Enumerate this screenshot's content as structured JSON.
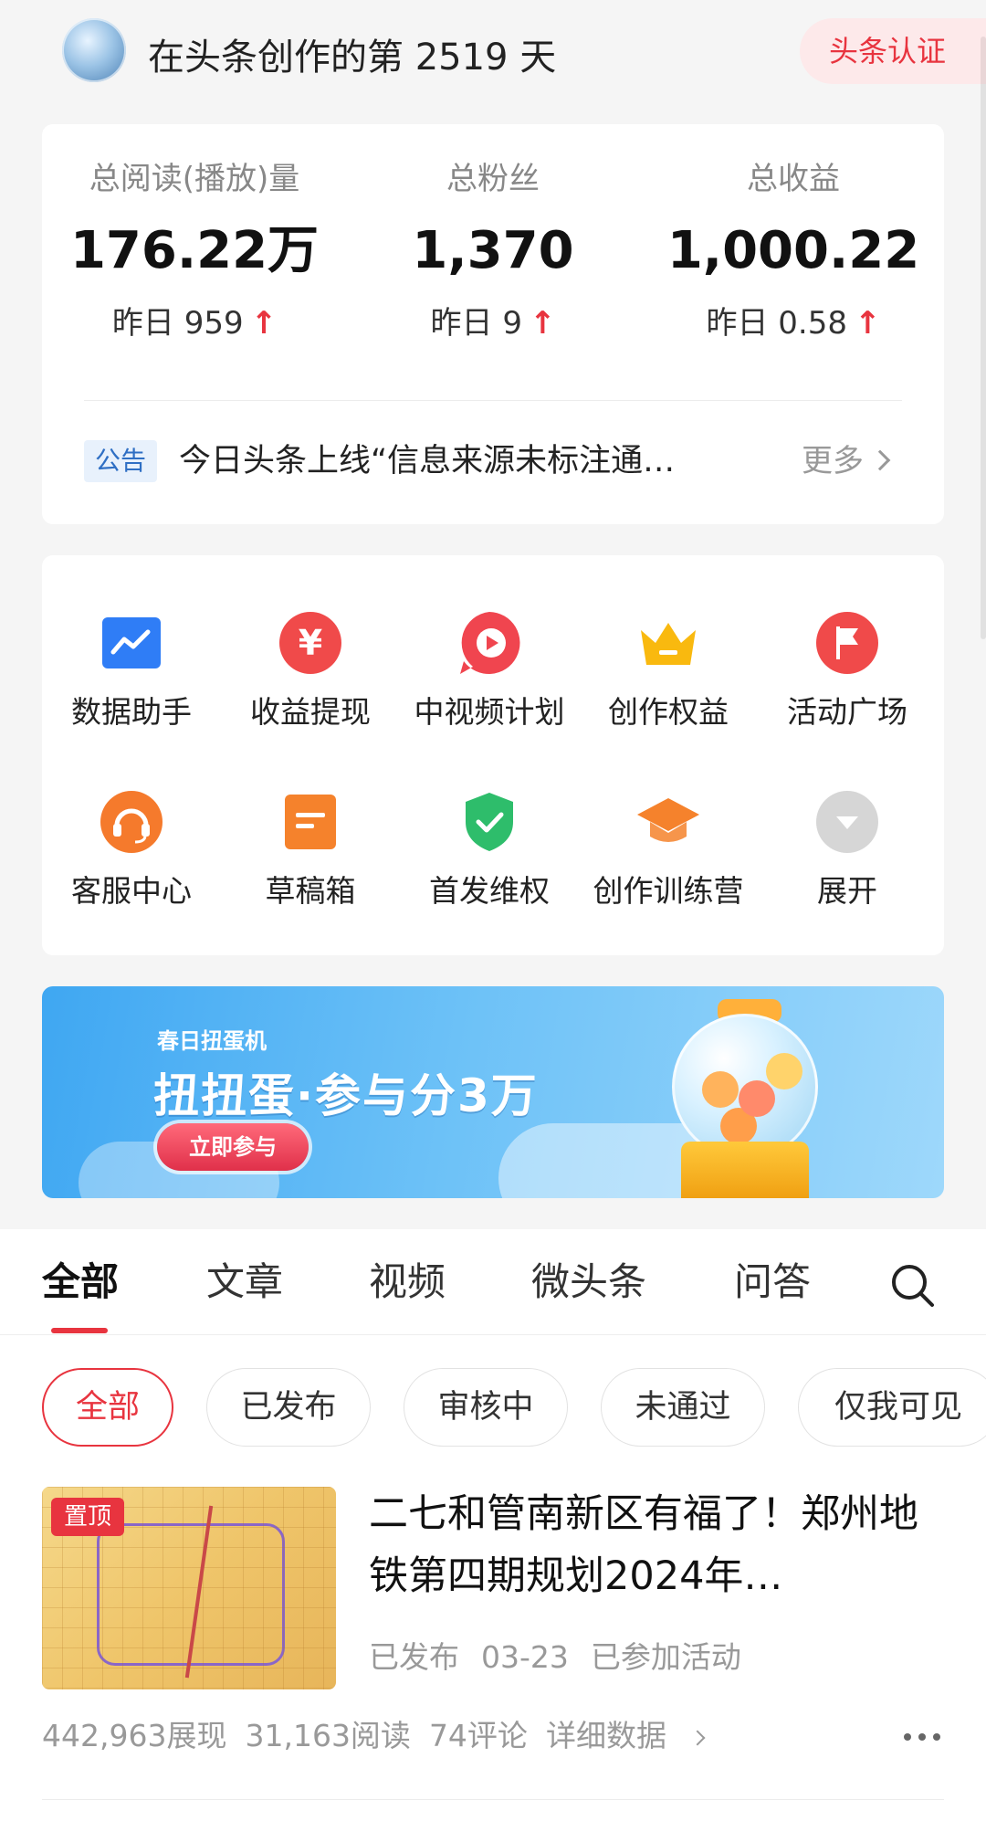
{
  "header": {
    "title": "在头条创作的第 2519 天",
    "verify_label": "头条认证"
  },
  "stats": [
    {
      "label": "总阅读(播放)量",
      "value": "176.22万",
      "delta_label": "昨日",
      "delta_value": "959"
    },
    {
      "label": "总粉丝",
      "value": "1,370",
      "delta_label": "昨日",
      "delta_value": "9"
    },
    {
      "label": "总收益",
      "value": "1,000.22",
      "delta_label": "昨日",
      "delta_value": "0.58"
    }
  ],
  "notice": {
    "tag": "公告",
    "text": "今日头条上线“信息来源未标注通知”…",
    "more": "更多"
  },
  "tools": [
    {
      "label": "数据助手",
      "icon": "chart-icon",
      "color": "#2f7df6"
    },
    {
      "label": "收益提现",
      "icon": "yuan-icon",
      "color": "#f04a4a"
    },
    {
      "label": "中视频计划",
      "icon": "play-icon",
      "color": "#f0454f"
    },
    {
      "label": "创作权益",
      "icon": "crown-icon",
      "color": "#f9b90f"
    },
    {
      "label": "活动广场",
      "icon": "flag-icon",
      "color": "#f04a4a"
    },
    {
      "label": "客服中心",
      "icon": "headset-icon",
      "color": "#f57a2c"
    },
    {
      "label": "草稿箱",
      "icon": "draft-icon",
      "color": "#f5822c"
    },
    {
      "label": "首发维权",
      "icon": "shield-check-icon",
      "color": "#2ebd6b"
    },
    {
      "label": "创作训练营",
      "icon": "graduation-cap-icon",
      "color": "#f5822c"
    },
    {
      "label": "展开",
      "icon": "expand-icon",
      "color": "#cccccc"
    }
  ],
  "banner": {
    "subtitle": "春日扭蛋机",
    "title": "扭扭蛋·参与分3万",
    "button": "立即参与"
  },
  "tabs": [
    "全部",
    "文章",
    "视频",
    "微头条",
    "问答"
  ],
  "active_tab": "全部",
  "filters": [
    "全部",
    "已发布",
    "审核中",
    "未通过",
    "仅我可见"
  ],
  "active_filter": "全部",
  "article": {
    "badge": "置顶",
    "title": "二七和管南新区有福了！郑州地铁第四期规划2024年…",
    "status": "已发布",
    "date": "03-23",
    "activity": "已参加活动",
    "impressions": "442,963展现",
    "reads": "31,163阅读",
    "comments": "74评论",
    "detail": "详细数据"
  },
  "colors": {
    "accent": "#e8343f",
    "background": "#f5f5f5"
  }
}
